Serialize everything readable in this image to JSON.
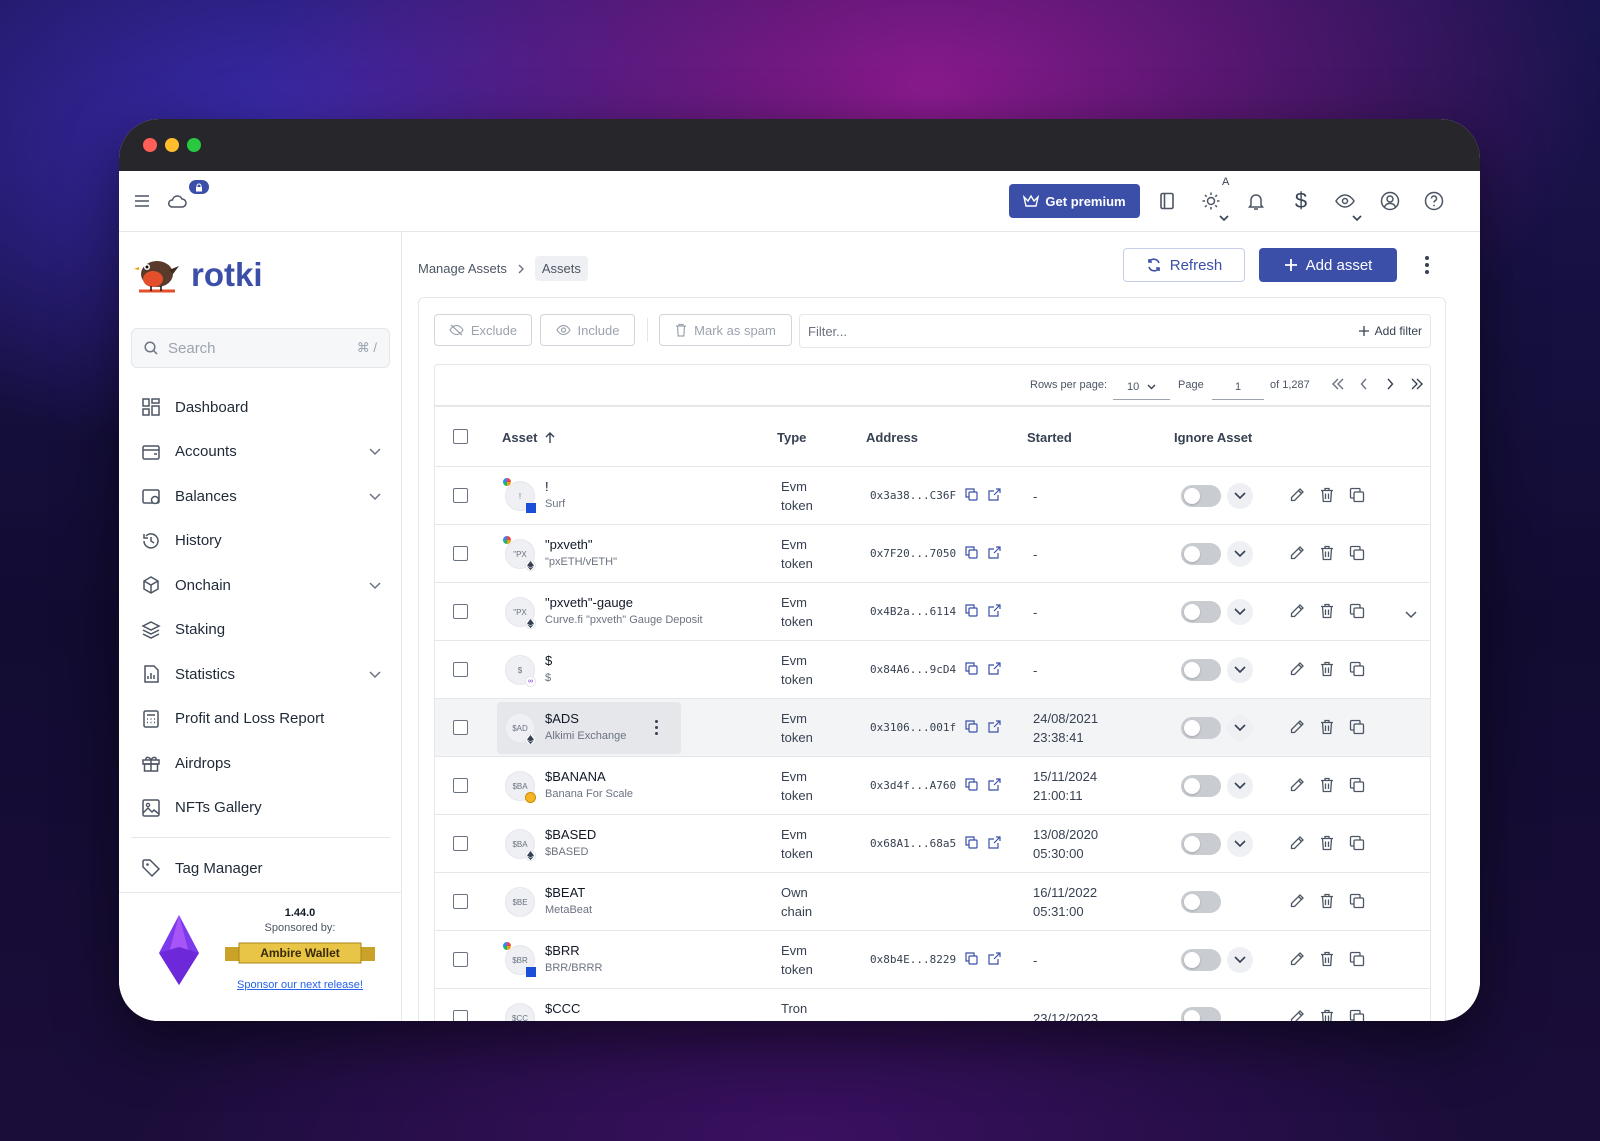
{
  "window": {
    "controls": {
      "close_color": "#ff5f57",
      "minimize_color": "#febc2e",
      "maximize_color": "#28c840"
    }
  },
  "topbar": {
    "menu_icon": "hamburger-icon",
    "cloud_icon": "cloud-icon",
    "lock_badge_icon": "lock-icon",
    "premium_label": "Get premium",
    "theme_badge": "A",
    "accent": "#3b4fa8"
  },
  "sidebar": {
    "brand": "rotki",
    "search_placeholder": "Search",
    "search_shortcut": "⌘ /",
    "items": [
      {
        "label": "Dashboard",
        "icon": "dashboard-icon",
        "expandable": false
      },
      {
        "label": "Accounts",
        "icon": "wallet-icon",
        "expandable": true
      },
      {
        "label": "Balances",
        "icon": "balances-icon",
        "expandable": true
      },
      {
        "label": "History",
        "icon": "history-icon",
        "expandable": false
      },
      {
        "label": "Onchain",
        "icon": "onchain-icon",
        "expandable": true
      },
      {
        "label": "Staking",
        "icon": "layers-icon",
        "expandable": false
      },
      {
        "label": "Statistics",
        "icon": "statistics-icon",
        "expandable": true
      },
      {
        "label": "Profit and Loss Report",
        "icon": "calculator-icon",
        "expandable": false
      },
      {
        "label": "Airdrops",
        "icon": "gift-icon",
        "expandable": false
      },
      {
        "label": "NFTs Gallery",
        "icon": "image-icon",
        "expandable": false
      }
    ],
    "tag_manager": "Tag Manager",
    "sponsor": {
      "version": "1.44.0",
      "sponsored_by": "Sponsored by:",
      "sponsor_name": "Ambire Wallet",
      "sponsor_link": "Sponsor our next release!"
    }
  },
  "main": {
    "breadcrumb": [
      "Manage Assets",
      "Assets"
    ],
    "refresh_label": "Refresh",
    "add_asset_label": "Add asset",
    "toolbar": {
      "exclude": "Exclude",
      "include": "Include",
      "mark_spam": "Mark as spam",
      "filter_placeholder": "Filter...",
      "add_filter": "Add filter"
    },
    "pager": {
      "rows_per_page_label": "Rows per page:",
      "rows_per_page": "10",
      "page_label": "Page",
      "page": "1",
      "of_total": "of 1,287"
    },
    "columns": [
      "Asset",
      "Type",
      "Address",
      "Started",
      "Ignore Asset"
    ],
    "rows": [
      {
        "avatar": "!",
        "name": "!",
        "sub": "Surf",
        "type1": "Evm",
        "type2": "token",
        "address": "0x3a38...C36F",
        "started1": "-",
        "started2": "",
        "has_dropdown": true,
        "has_links": true
      },
      {
        "avatar": "\"PX",
        "name": "\"pxveth\"",
        "sub": "\"pxETH/vETH\"",
        "type1": "Evm",
        "type2": "token",
        "address": "0x7F20...7050",
        "started1": "-",
        "started2": "",
        "has_dropdown": true,
        "has_links": true
      },
      {
        "avatar": "\"PX",
        "name": "\"pxveth\"-gauge",
        "sub": "Curve.fi \"pxveth\" Gauge Deposit",
        "type1": "Evm",
        "type2": "token",
        "address": "0x4B2a...6114",
        "started1": "-",
        "started2": "",
        "has_dropdown": true,
        "has_links": true
      },
      {
        "avatar": "$",
        "name": "$",
        "sub": "$",
        "type1": "Evm",
        "type2": "token",
        "address": "0x84A6...9cD4",
        "started1": "-",
        "started2": "",
        "has_dropdown": true,
        "has_links": true
      },
      {
        "avatar": "$AD",
        "name": "$ADS",
        "sub": "Alkimi Exchange",
        "type1": "Evm",
        "type2": "token",
        "address": "0x3106...001f",
        "started1": "24/08/2021",
        "started2": "23:38:41",
        "has_dropdown": true,
        "has_links": true
      },
      {
        "avatar": "$BA",
        "name": "$BANANA",
        "sub": "Banana For Scale",
        "type1": "Evm",
        "type2": "token",
        "address": "0x3d4f...A760",
        "started1": "15/11/2024",
        "started2": "21:00:11",
        "has_dropdown": true,
        "has_links": true
      },
      {
        "avatar": "$BA",
        "name": "$BASED",
        "sub": "$BASED",
        "type1": "Evm",
        "type2": "token",
        "address": "0x68A1...68a5",
        "started1": "13/08/2020",
        "started2": "05:30:00",
        "has_dropdown": true,
        "has_links": true
      },
      {
        "avatar": "$BE",
        "name": "$BEAT",
        "sub": "MetaBeat",
        "type1": "Own",
        "type2": "chain",
        "address": "",
        "started1": "16/11/2022",
        "started2": "05:31:00",
        "has_dropdown": false,
        "has_links": false
      },
      {
        "avatar": "$BR",
        "name": "$BRR",
        "sub": "BRR/BRRR",
        "type1": "Evm",
        "type2": "token",
        "address": "0x8b4E...8229",
        "started1": "-",
        "started2": "",
        "has_dropdown": true,
        "has_links": true
      },
      {
        "avatar": "$CC",
        "name": "$CCC",
        "sub": "",
        "type1": "Tron",
        "type2": "",
        "address": "",
        "started1": "23/12/2023",
        "started2": "",
        "has_dropdown": false,
        "has_links": false
      }
    ]
  }
}
